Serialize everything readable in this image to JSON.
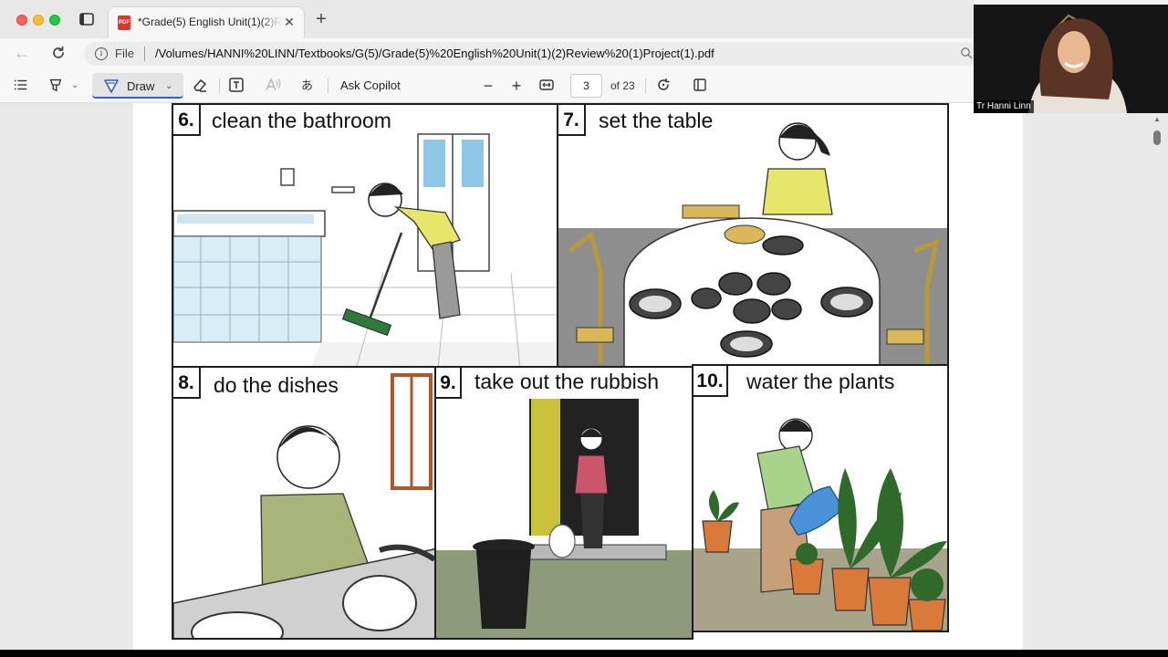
{
  "browser": {
    "tab_title": "*Grade(5) English Unit(1)(2)Rev",
    "tab_icon_text": "PDF",
    "tab_close": "✕",
    "new_tab": "+",
    "address_scheme": "File",
    "address_url": "/Volumes/HANNI%20LINN/Textbooks/G(5)/Grade(5)%20English%20Unit(1)(2)Review%20(1)Project(1).pdf"
  },
  "toolbar": {
    "draw_label": "Draw",
    "translate_glyph": "あ",
    "ask_copilot": "Ask Copilot",
    "zoom_out": "−",
    "zoom_in": "+",
    "current_page": "3",
    "page_count": "of 23"
  },
  "worksheet": {
    "panels": [
      {
        "number": "6.",
        "caption": "clean the bathroom"
      },
      {
        "number": "7.",
        "caption": "set the table"
      },
      {
        "number": "8.",
        "caption": "do the dishes"
      },
      {
        "number": "9.",
        "caption": "take out the rubbish"
      },
      {
        "number": "10.",
        "caption": "water the plants"
      }
    ]
  },
  "webcam": {
    "participant_name": "Tr Hanni Linn"
  },
  "colors": {
    "accent": "#2d5fd6",
    "pdf_red": "#e2342c",
    "shirt_yellow": "#e6e76a",
    "shirt_green": "#a8d48a",
    "pot_orange": "#d97a3a"
  }
}
